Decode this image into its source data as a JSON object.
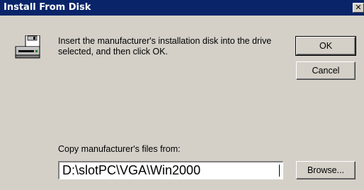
{
  "window": {
    "title": "Install From Disk",
    "close_glyph": "✕"
  },
  "icons": {
    "disk": "floppy-disk-drive-icon",
    "close": "close-icon"
  },
  "message": "Insert the manufacturer's installation disk into the drive selected, and then click OK.",
  "buttons": {
    "ok": "OK",
    "cancel": "Cancel",
    "browse": "Browse..."
  },
  "copy_from": {
    "label": "Copy manufacturer's files from:",
    "value": "D:\\slotPC\\VGA\\Win2000"
  },
  "colors": {
    "titlebar": "#0a246a",
    "face": "#d4d0c8"
  }
}
